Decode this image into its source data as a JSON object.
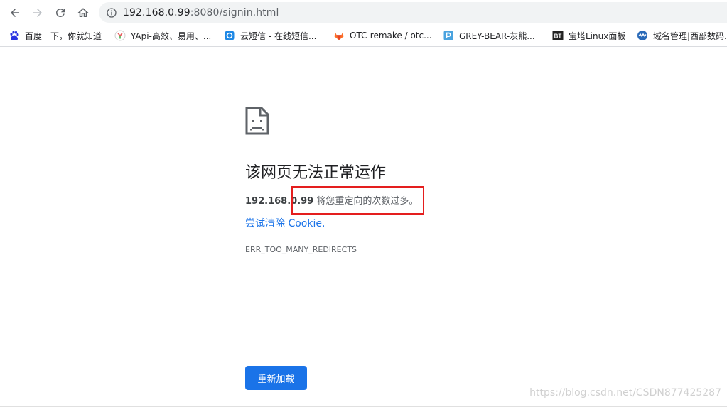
{
  "toolbar": {
    "url_host": "192.168.0.99",
    "url_rest": ":8080/signin.html"
  },
  "bookmarks": [
    {
      "label": "百度一下，你就知道",
      "icon": "baidu-paw-icon"
    },
    {
      "label": "YApi-高效、易用、...",
      "icon": "yapi-icon"
    },
    {
      "label": "云短信 - 在线短信...",
      "icon": "cloud-sms-icon"
    },
    {
      "label": "OTC-remake / otc...",
      "icon": "gitlab-icon"
    },
    {
      "label": "GREY-BEAR-灰熊...",
      "icon": "p-logo-icon"
    },
    {
      "label": "宝塔Linux面板",
      "icon": "bt-icon"
    },
    {
      "label": "域名管理|西部数码...",
      "icon": "west-icon"
    }
  ],
  "error": {
    "title": "该网页无法正常运作",
    "host": "192.168.0.99",
    "message": " 将您重定向的次数过多。",
    "link": "尝试清除 Cookie.",
    "code": "ERR_TOO_MANY_REDIRECTS",
    "reload_label": "重新加载"
  },
  "watermark": "https://blog.csdn.net/CSDN877425287",
  "colors": {
    "accent": "#1a73e8",
    "highlight_box": "#e41e1e"
  }
}
